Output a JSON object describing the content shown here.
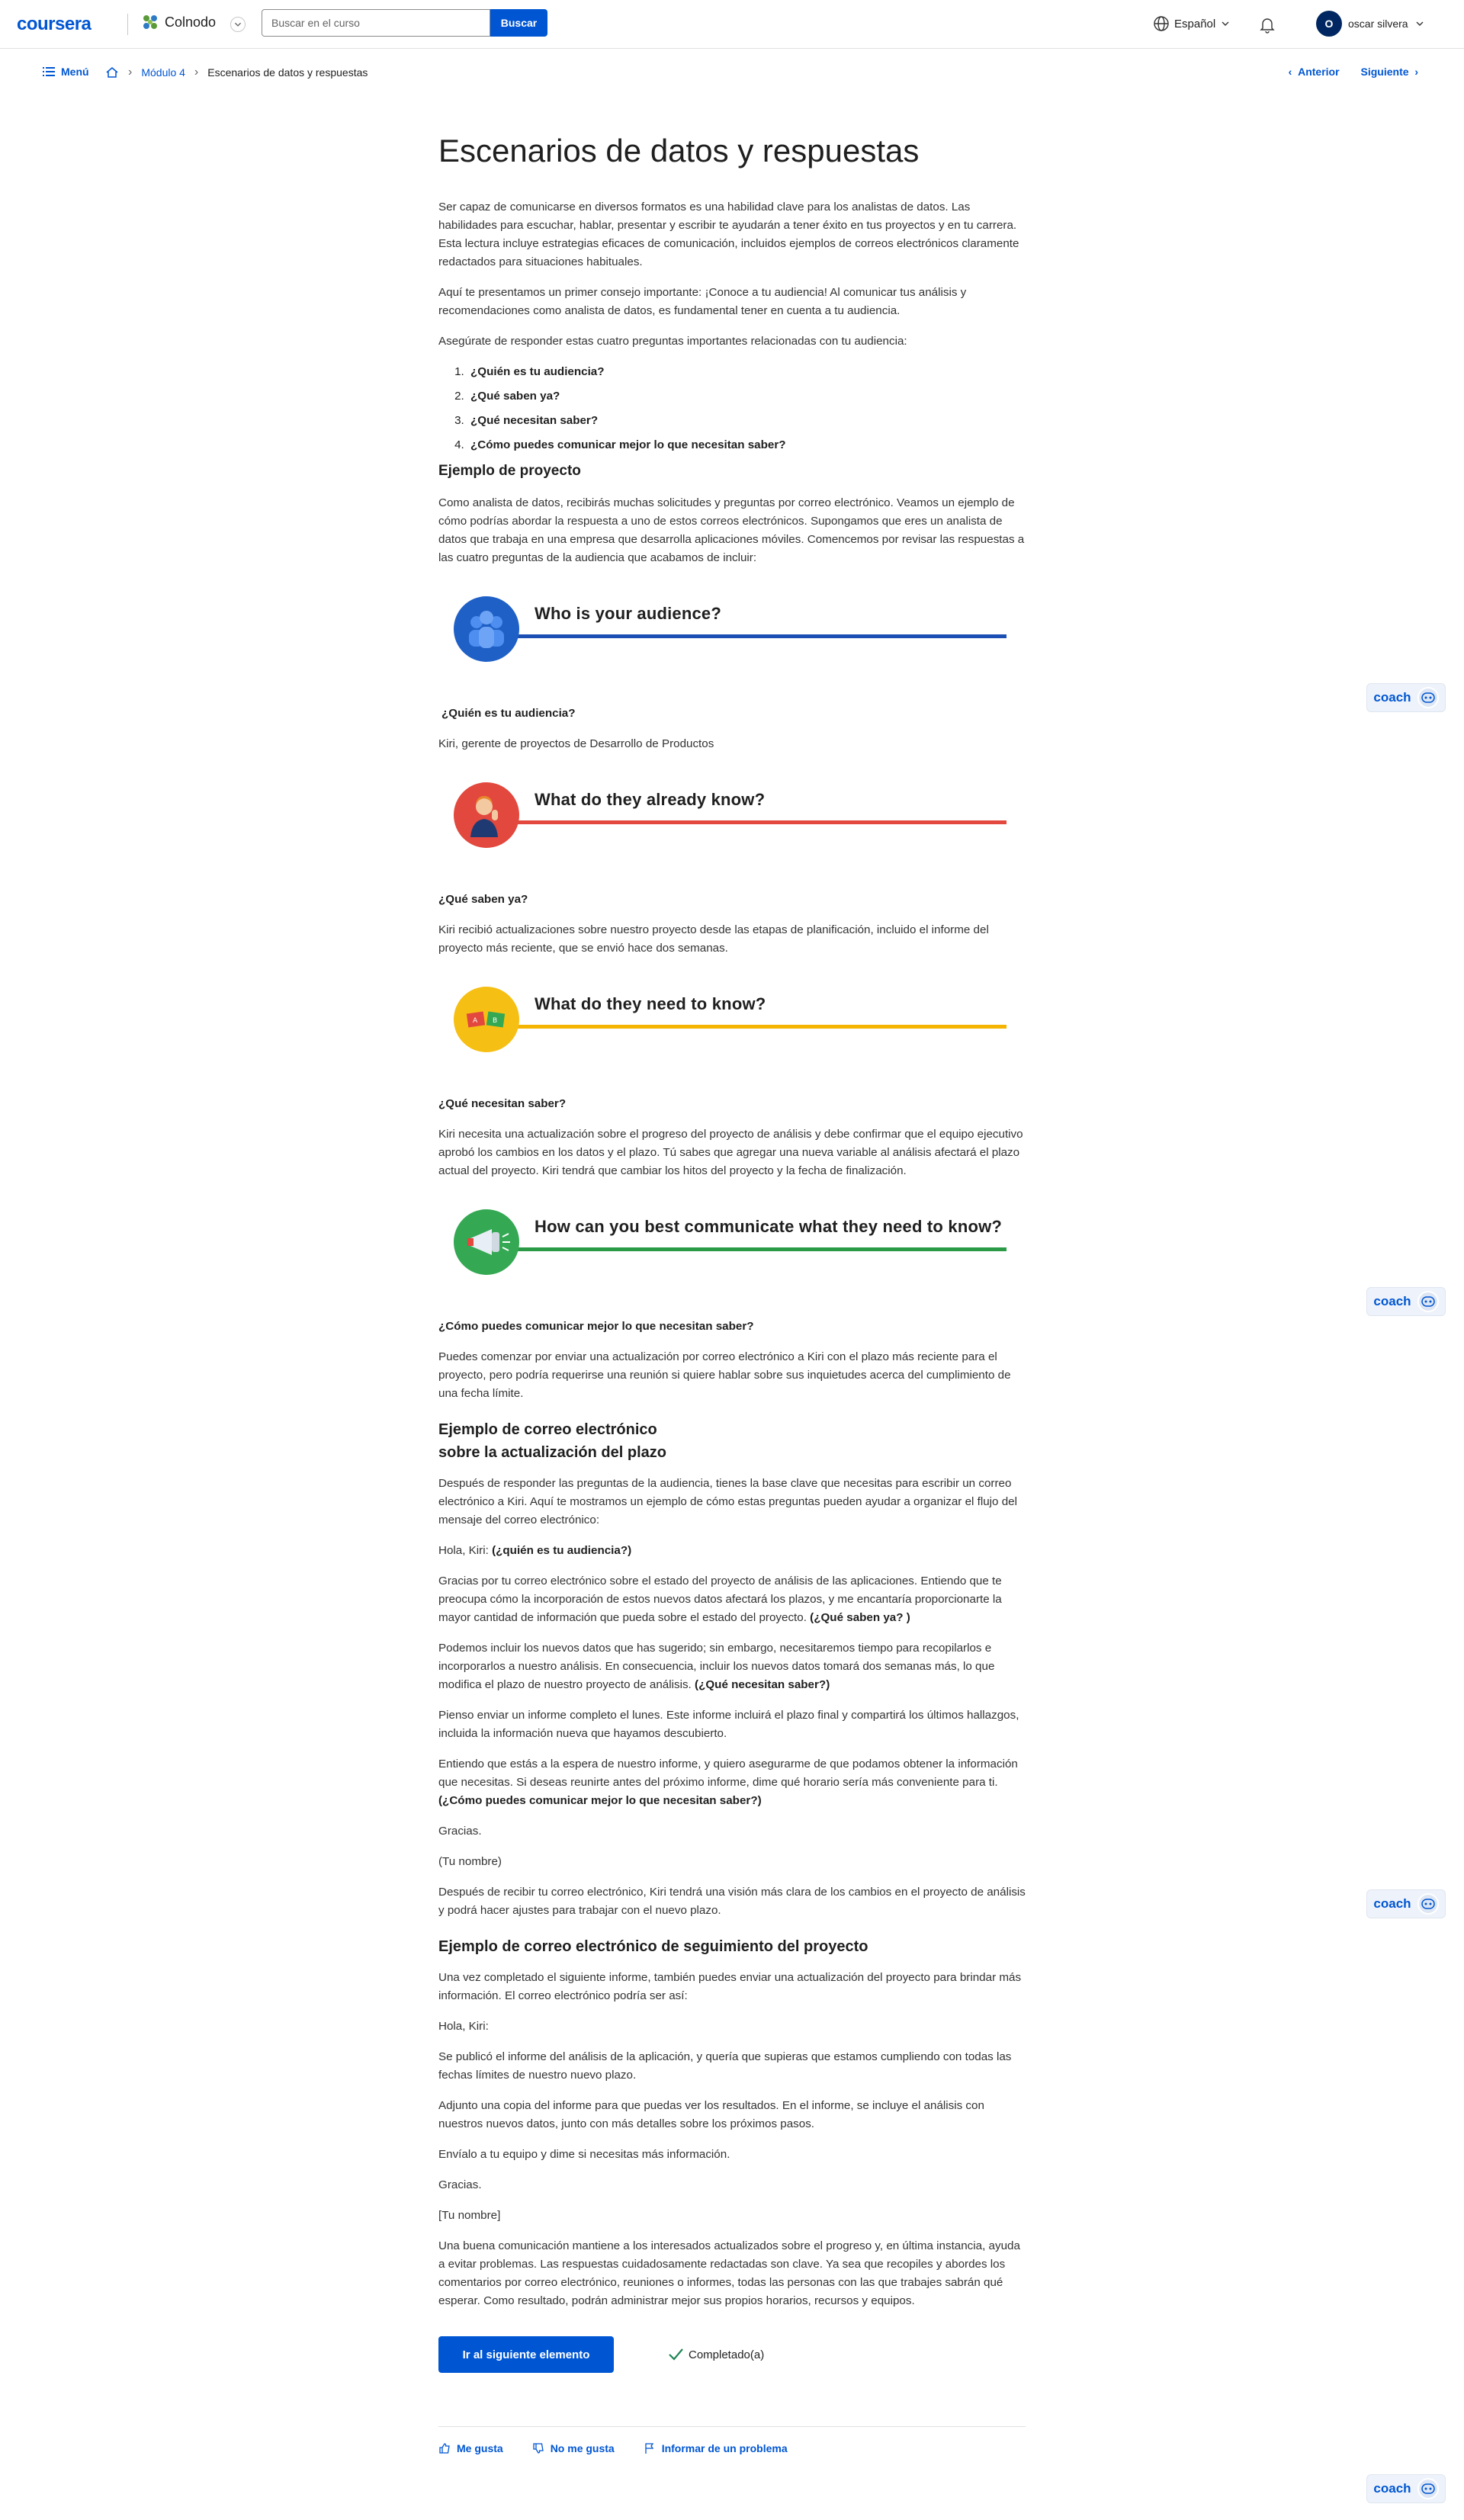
{
  "header": {
    "brand": "coursera",
    "partner": "Colnodo",
    "search_placeholder": "Buscar en el curso",
    "search_button": "Buscar",
    "language": "Español",
    "user_initial": "O",
    "user_name": "oscar silvera"
  },
  "breadcrumb": {
    "menu": "Menú",
    "module": "Módulo 4",
    "current": "Escenarios de datos y respuestas",
    "prev": "Anterior",
    "next": "Siguiente"
  },
  "article": {
    "title": "Escenarios de datos y respuestas",
    "intro1": "Ser capaz de comunicarse en diversos formatos es una habilidad clave para los analistas de datos. Las habilidades para escuchar, hablar, presentar y escribir te ayudarán a tener éxito en tus proyectos y en tu carrera. Esta lectura incluye estrategias eficaces de comunicación, incluidos ejemplos de correos electrónicos claramente redactados para situaciones habituales.",
    "intro2": "Aquí te presentamos un primer consejo importante: ¡Conoce a tu audiencia! Al comunicar tus análisis y recomendaciones como analista de datos, es fundamental tener en cuenta a tu audiencia.",
    "intro3": "Asegúrate de responder estas cuatro preguntas importantes relacionadas con tu audiencia:",
    "questions": [
      "¿Quién es tu audiencia?",
      "¿Qué saben ya?",
      "¿Qué necesitan saber?",
      "¿Cómo puedes comunicar mejor lo que necesitan saber?"
    ],
    "project_heading": "Ejemplo de proyecto",
    "project_text": "Como analista de datos, recibirás muchas solicitudes y preguntas por correo electrónico. Veamos un ejemplo de cómo podrías abordar la respuesta a uno de estos correos electrónicos. Supongamos que eres un analista de datos que trabaja en una empresa que desarrolla aplicaciones móviles. Comencemos por revisar las respuestas a las cuatro preguntas de la audiencia que acabamos de incluir:",
    "banners": [
      {
        "text": "Who is your audience?",
        "color": "#1b4fb3",
        "circle": "#1f60c6",
        "icon": "people-icon"
      },
      {
        "text": "What do they already know?",
        "color": "#e2483d",
        "circle": "#e2483d",
        "icon": "person-icon"
      },
      {
        "text": "What do they need to know?",
        "color": "#f4b400",
        "circle": "#f6bf14",
        "icon": "flags-icon"
      },
      {
        "text": "How can you best communicate what they need to know?",
        "color": "#2b9a47",
        "circle": "#34a853",
        "icon": "megaphone-icon"
      }
    ],
    "q1_head": "¿Quién es tu audiencia?",
    "q1_text": "Kiri, gerente de proyectos de Desarrollo de Productos",
    "q2_head": "¿Qué saben ya?",
    "q2_text": "Kiri recibió actualizaciones sobre nuestro proyecto desde las etapas de planificación, incluido el informe del proyecto más reciente, que se envió hace dos semanas.",
    "q3_head": "¿Qué necesitan saber?",
    "q3_text": "Kiri necesita una actualización sobre el progreso del proyecto de análisis y debe confirmar que el equipo ejecutivo aprobó los cambios en los datos y el plazo. Tú sabes que agregar una nueva variable al análisis afectará el plazo actual del proyecto. Kiri tendrá que cambiar los hitos del proyecto y la fecha de finalización.",
    "q4_head": "¿Cómo puedes comunicar mejor lo que necesitan saber?",
    "q4_text": "Puedes comenzar por enviar una actualización por correo electrónico a Kiri con el plazo más reciente para el proyecto, pero podría requerirse una reunión si quiere hablar sobre sus inquietudes acerca del cumplimiento de una fecha límite.",
    "email1_heading_l1": "Ejemplo de correo electrónico",
    "email1_heading_l2": "sobre la actualización del plazo",
    "email1_intro": "Después de responder las preguntas de la audiencia, tienes la base clave que necesitas para escribir un correo electrónico a Kiri. Aquí te mostramos un ejemplo de cómo estas preguntas pueden ayudar a organizar el flujo del mensaje del correo electrónico:",
    "email1_greet": "Hola, Kiri: ",
    "email1_greet_b": "(¿quién es tu audiencia?)",
    "email1_p1": "Gracias por tu correo electrónico sobre el estado del proyecto de análisis de las aplicaciones. Entiendo que te preocupa cómo la incorporación de estos nuevos datos afectará los plazos, y me encantaría proporcionarte la mayor cantidad de información que pueda sobre el estado del proyecto. ",
    "email1_p1_b": "(¿Qué saben ya? )",
    "email1_p2": "Podemos incluir los nuevos datos que has sugerido; sin embargo, necesitaremos tiempo para recopilarlos e incorporarlos a nuestro análisis. En consecuencia, incluir los nuevos datos tomará dos semanas más, lo que modifica el plazo de nuestro proyecto de análisis. ",
    "email1_p2_b": "(¿Qué necesitan saber?)",
    "email1_p3": "Pienso enviar un informe completo el lunes. Este informe incluirá el plazo final y compartirá los últimos hallazgos, incluida la información nueva que hayamos descubierto.",
    "email1_p4": "Entiendo que estás a la espera de nuestro informe, y quiero asegurarme de que podamos obtener la información que necesitas. Si deseas reunirte antes del próximo informe, dime qué horario sería más conveniente para ti.",
    "email1_p4_b": "(¿Cómo puedes comunicar mejor lo que necesitan saber?)",
    "email1_thanks": "Gracias.",
    "email1_sign": "(Tu nombre)",
    "email1_after": "Después de recibir tu correo electrónico, Kiri tendrá una visión más clara de los cambios en el proyecto de análisis y podrá hacer ajustes para trabajar con el nuevo plazo.",
    "email2_heading": "Ejemplo de correo electrónico de seguimiento del proyecto",
    "email2_intro": "Una vez completado el siguiente informe, también puedes enviar una actualización del proyecto para brindar más información. El correo electrónico podría ser así:",
    "email2_greet": "Hola, Kiri:",
    "email2_p1": "Se publicó el informe del análisis de la aplicación, y quería que supieras que estamos cumpliendo con todas las fechas límites de nuestro nuevo plazo.",
    "email2_p2": "Adjunto una copia del informe para que puedas ver los resultados. En el informe, se incluye el análisis con nuestros nuevos datos, junto con más detalles sobre los próximos pasos.",
    "email2_p3": "Envíalo a tu equipo y dime si necesitas más información.",
    "email2_thanks": "Gracias.",
    "email2_sign": "[Tu nombre]",
    "closing": "Una buena comunicación mantiene a los interesados actualizados sobre el progreso y, en última instancia, ayuda a evitar problemas. Las respuestas cuidadosamente redactadas son clave. Ya sea que recopiles y abordes los comentarios por correo electrónico, reuniones o informes, todas las personas con las que trabajes sabrán qué esperar. Como resultado, podrán administrar mejor sus propios horarios, recursos y equipos."
  },
  "footer_actions": {
    "next_item": "Ir al siguiente elemento",
    "completed": "Completado(a)",
    "like": "Me gusta",
    "dislike": "No me gusta",
    "report": "Informar de un problema"
  },
  "coach_label": "coach",
  "colors": {
    "accent": "#0056d2",
    "success": "#1f8354"
  }
}
